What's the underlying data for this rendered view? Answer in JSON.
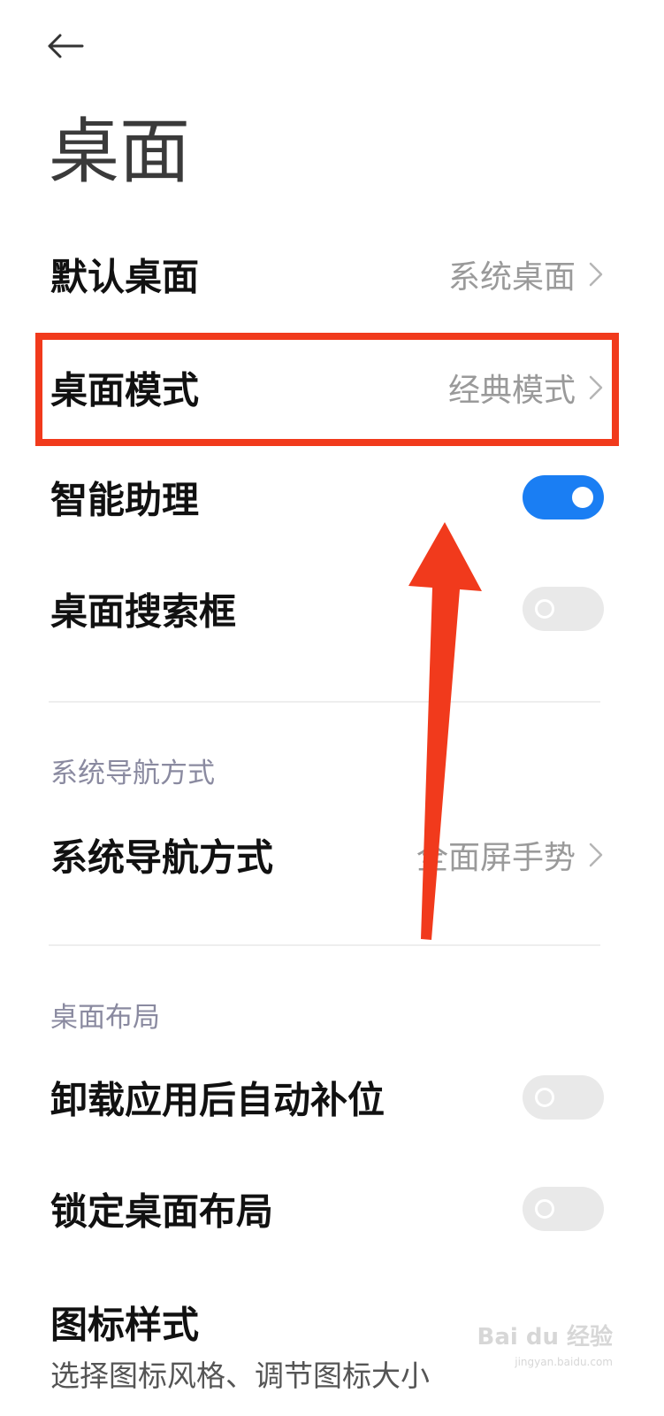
{
  "header": {
    "title": "桌面"
  },
  "settings": {
    "default_launcher": {
      "label": "默认桌面",
      "value": "系统桌面"
    },
    "launcher_mode": {
      "label": "桌面模式",
      "value": "经典模式"
    },
    "smart_assistant": {
      "label": "智能助理",
      "enabled": true
    },
    "home_search_bar": {
      "label": "桌面搜索框",
      "enabled": false
    }
  },
  "navigation_section": {
    "header": "系统导航方式",
    "item": {
      "label": "系统导航方式",
      "value": "全面屏手势"
    }
  },
  "layout_section": {
    "header": "桌面布局",
    "auto_fill": {
      "label": "卸载应用后自动补位",
      "enabled": false
    },
    "lock_layout": {
      "label": "锁定桌面布局",
      "enabled": false
    },
    "icon_style": {
      "label": "图标样式",
      "sublabel": "选择图标风格、调节图标大小"
    }
  },
  "watermark": {
    "text": "Bai du 经验",
    "sub": "jingyan.baidu.com"
  },
  "colors": {
    "accent": "#1a7ef3",
    "annotation": "#f13a1c"
  }
}
